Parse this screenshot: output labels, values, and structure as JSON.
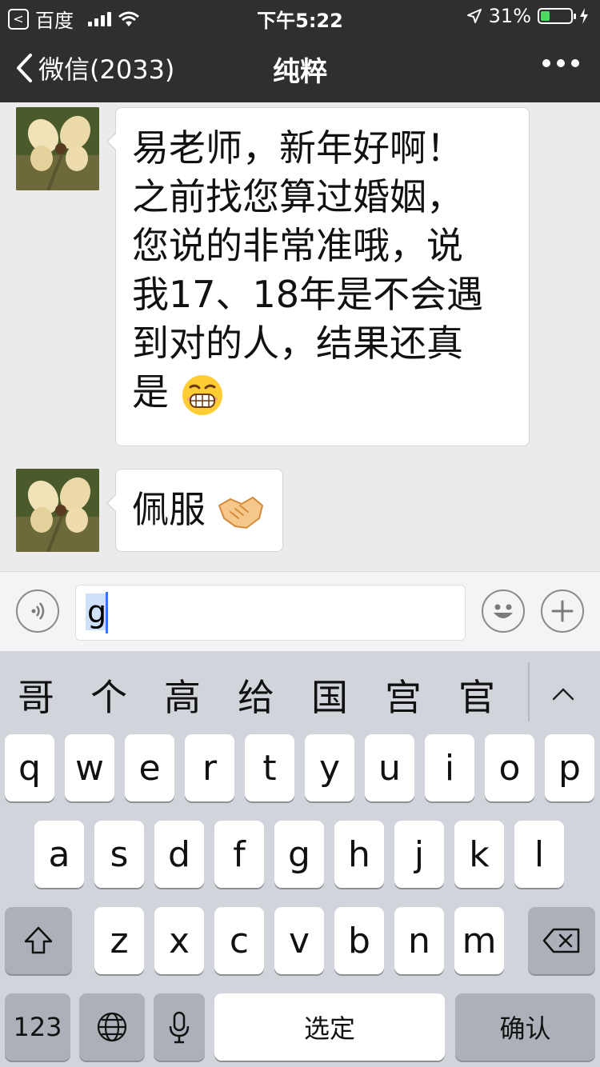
{
  "status_bar": {
    "back_app_label": "百度",
    "time": "下午5:22",
    "battery_percent": "31%",
    "battery_level": 0.31
  },
  "nav": {
    "back_label": "微信(2033)",
    "title": "纯粹"
  },
  "messages": [
    {
      "lines": [
        "易老师，新年好啊！",
        "之前找您算过婚姻，",
        "您说的非常准哦，说",
        "我17、18年是不会遇",
        "到对的人，结果还真",
        "是"
      ],
      "emoji": "grinning-face-emoji"
    },
    {
      "lines": [
        "佩服"
      ],
      "emoji": "handshake-emoji"
    }
  ],
  "input": {
    "text": "g"
  },
  "keyboard": {
    "candidates": [
      "哥",
      "个",
      "高",
      "给",
      "国",
      "宫",
      "官"
    ],
    "row1": [
      "q",
      "w",
      "e",
      "r",
      "t",
      "y",
      "u",
      "i",
      "o",
      "p"
    ],
    "row2": [
      "a",
      "s",
      "d",
      "f",
      "g",
      "h",
      "j",
      "k",
      "l"
    ],
    "row3": [
      "z",
      "x",
      "c",
      "v",
      "b",
      "n",
      "m"
    ],
    "numbers_label": "123",
    "space_label": "选定",
    "confirm_label": "确认"
  },
  "colors": {
    "nav_background": "#2f2f2f",
    "chat_background": "#ebebeb",
    "battery_fill": "#4cd964",
    "keyboard_background": "#d1d4da"
  }
}
